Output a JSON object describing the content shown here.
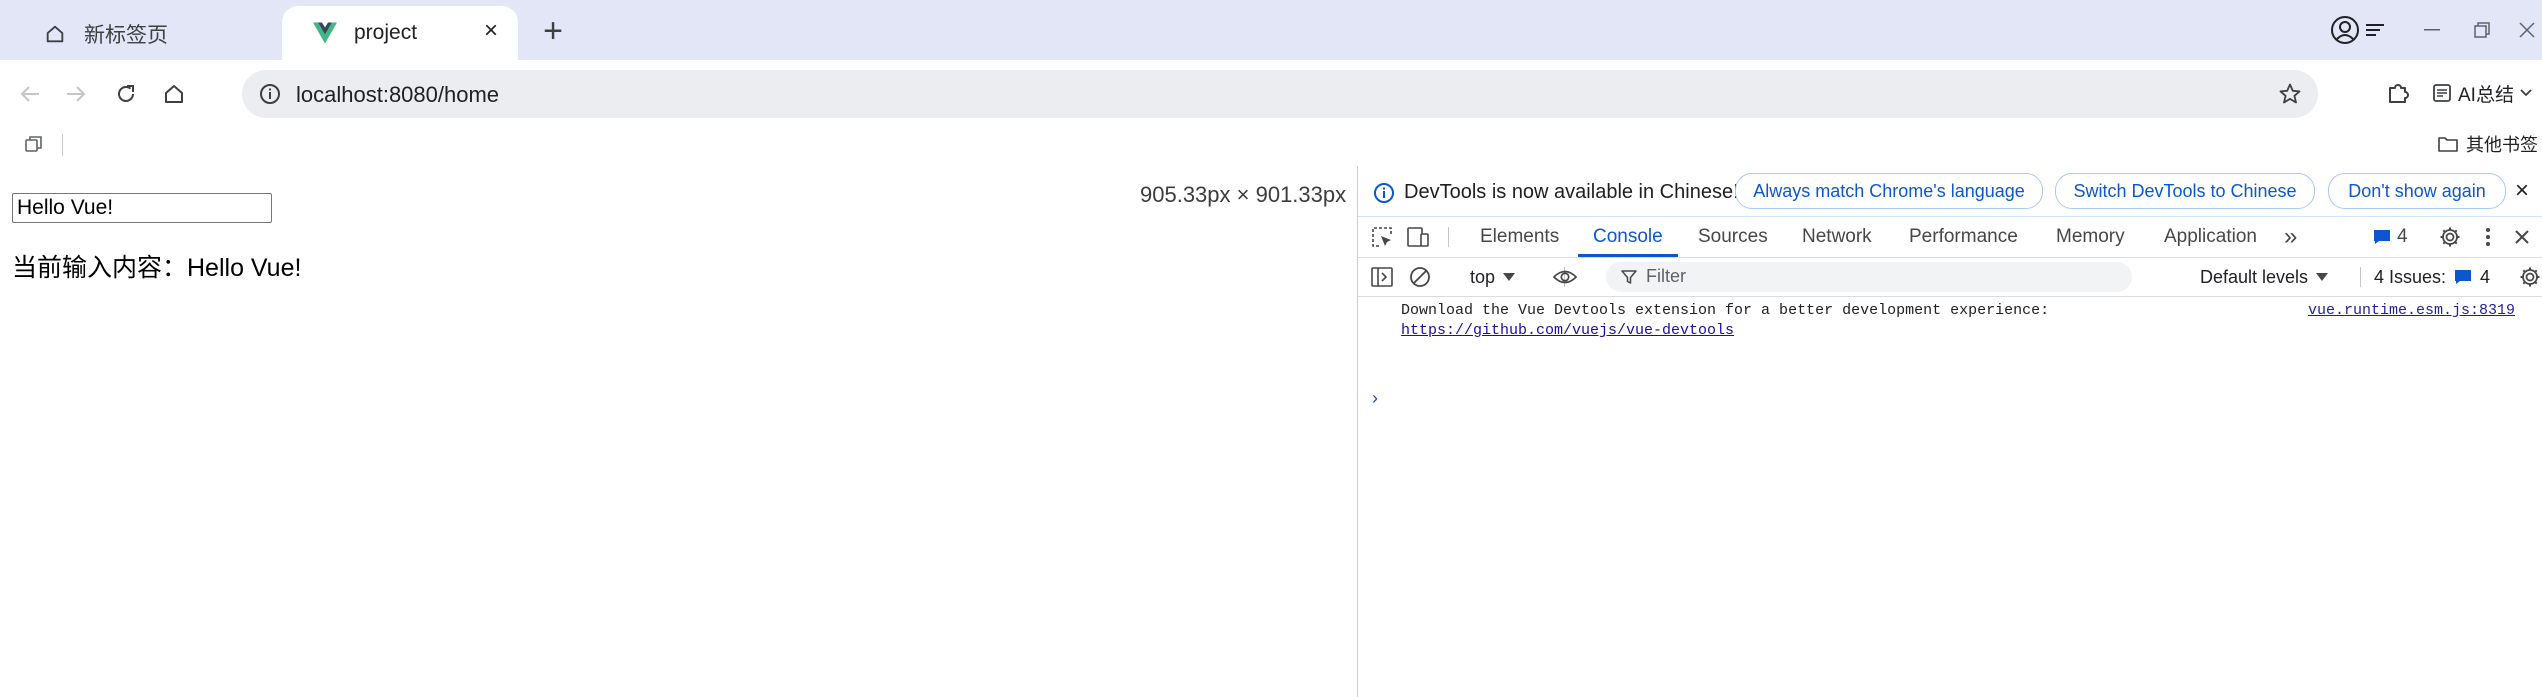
{
  "browser": {
    "tabs": [
      {
        "title": "新标签页",
        "active": false
      },
      {
        "title": "project",
        "active": true
      }
    ],
    "new_tab_symbol": "+",
    "address": "localhost:8080/home",
    "ai_summary_label": "AI总结",
    "other_bookmarks_label": "其他书签",
    "icons": [
      "back-arrow-icon",
      "forward-arrow-icon",
      "reload-icon",
      "home-icon",
      "site-info-icon",
      "star-icon",
      "extensions-icon",
      "profile-icon",
      "vue-logo-icon"
    ]
  },
  "page": {
    "input_value": "Hello Vue!",
    "content_line": "当前输入内容：Hello Vue!",
    "viewport_dimensions": "905.33px × 901.33px"
  },
  "devtools": {
    "infobar": {
      "message": "DevTools is now available in Chinese!",
      "buttons": [
        "Always match Chrome's language",
        "Switch DevTools to Chinese",
        "Don't show again"
      ]
    },
    "tabs": [
      "Elements",
      "Console",
      "Sources",
      "Network",
      "Performance",
      "Memory",
      "Application"
    ],
    "active_tab": "Console",
    "more_tabs_symbol": "»",
    "message_count": "4",
    "console_toolbar": {
      "context": "top",
      "filter_placeholder": "Filter",
      "levels": "Default levels",
      "issues_label": "4 Issues:",
      "issues_count": "4"
    },
    "messages": [
      {
        "text": "Download the Vue Devtools extension for a better development experience:",
        "link": "https://github.com/vuejs/vue-devtools",
        "source": "vue.runtime.esm.js:8319"
      }
    ],
    "prompt_symbol": "›"
  },
  "colors": {
    "tabstrip_bg": "#e3e6f6",
    "accent_blue": "#0b57d0",
    "vue_green": "#41b883",
    "vue_dark": "#35495e"
  }
}
